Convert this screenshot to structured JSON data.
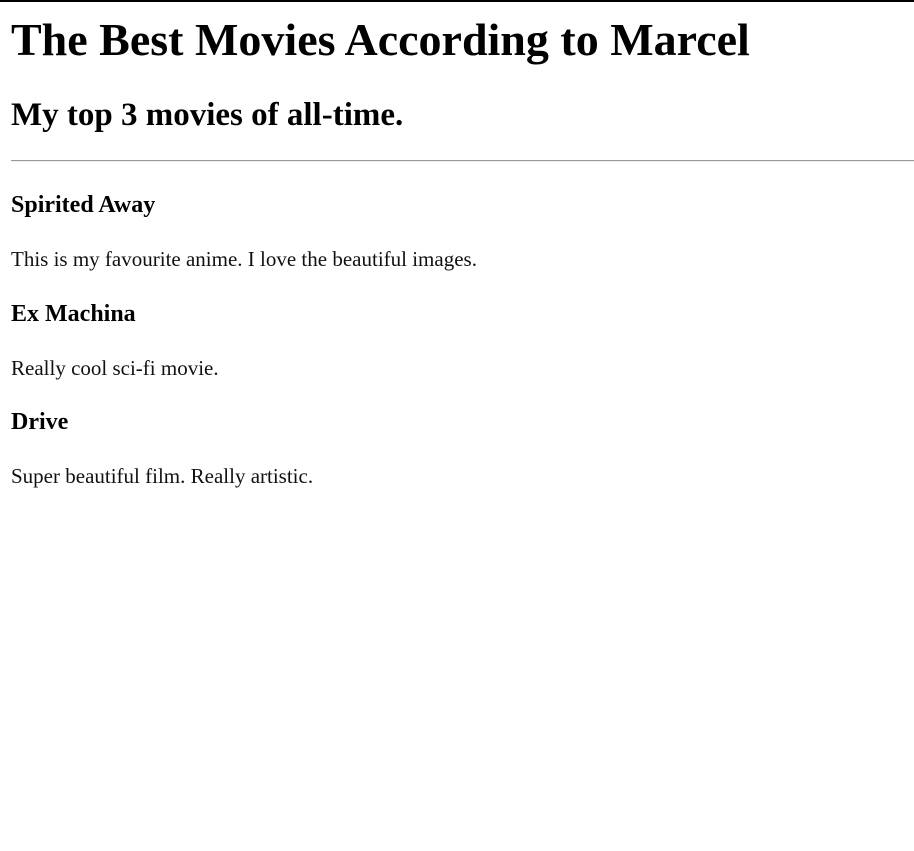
{
  "page": {
    "title": "The Best Movies According to Marcel",
    "subtitle": "My top 3 movies of all-time."
  },
  "movies": [
    {
      "title": "Spirited Away",
      "description": "This is my favourite anime. I love the beautiful images."
    },
    {
      "title": "Ex Machina",
      "description": "Really cool sci-fi movie."
    },
    {
      "title": "Drive",
      "description": "Super beautiful film. Really artistic."
    }
  ]
}
